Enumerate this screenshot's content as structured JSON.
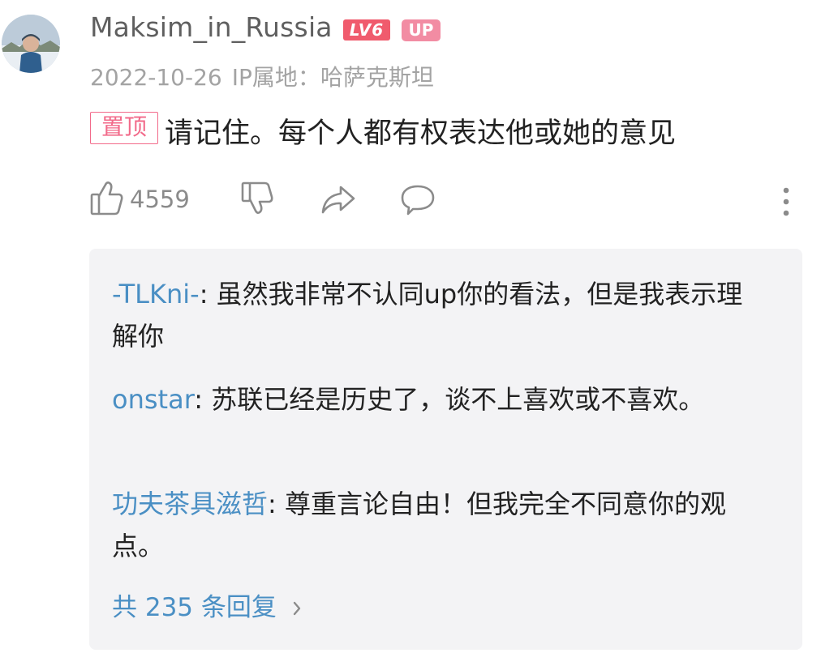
{
  "comment": {
    "avatar_icon": "user-avatar",
    "username": "Maksim_in_Russia",
    "level_badge": "LV6",
    "up_badge": "UP",
    "date": "2022-10-26",
    "ip_location": "IP属地：哈萨克斯坦",
    "pinned_tag": "置顶",
    "text": "请记住。每个人都有权表达他或她的意见",
    "likes": "4559",
    "icons": [
      "thumbs-up-icon",
      "thumbs-down-icon",
      "share-icon",
      "comment-icon",
      "more-icon"
    ]
  },
  "replies": {
    "items": [
      {
        "name": "-TLKni-",
        "text": ": 虽然我非常不认同up你的看法，但是我表示理解你"
      },
      {
        "name": "onstar",
        "text": ": 苏联已经是历史了，谈不上喜欢或不喜欢。"
      },
      {
        "name": "功夫茶具滋哲",
        "text": ": 尊重言论自由！但我完全不同意你的观点。"
      }
    ],
    "total_label": "共 235 条回复"
  },
  "colors": {
    "link_blue": "#4a8fc4",
    "pink_accent": "#f26a8a",
    "level_red": "#f05b6d",
    "reply_bg": "#f3f3f5"
  }
}
